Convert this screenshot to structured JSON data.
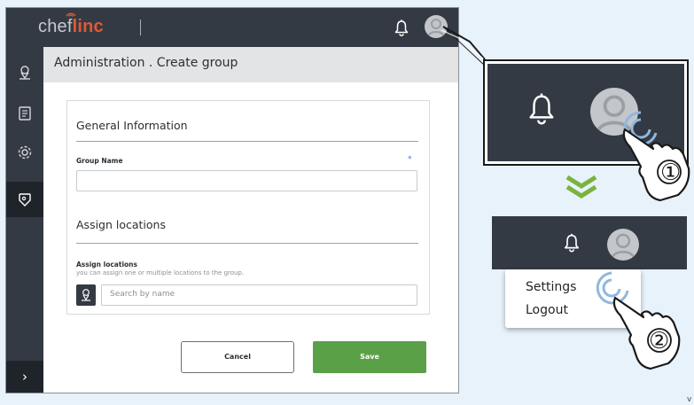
{
  "app": {
    "logo_prefix": "chef",
    "logo_suffix": "linc"
  },
  "header": {
    "title": "Administration . Create group"
  },
  "form": {
    "general_title": "General Information",
    "group_name_label": "Group Name",
    "required_mark": "*",
    "assign_title": "Assign locations",
    "assign_label": "Assign locations",
    "assign_hint": "you can assign one or multiple locations to the group.",
    "search_placeholder": "Search by name"
  },
  "buttons": {
    "cancel": "Cancel",
    "save": "Save"
  },
  "menu": {
    "settings": "Settings",
    "logout": "Logout"
  },
  "steps": {
    "one": "①",
    "two": "②"
  },
  "sidebar": {
    "expand": "›"
  },
  "corner": "v",
  "colors": {
    "dark": "#343a43",
    "accent_green": "#5aa046",
    "logo_orange": "#e05a35",
    "highlight_blue": "#8fb8e0"
  }
}
